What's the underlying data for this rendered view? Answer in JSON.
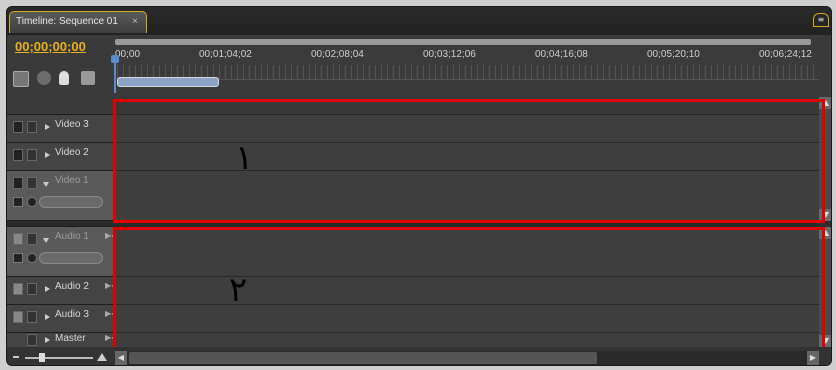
{
  "panel": {
    "tab_title": "Timeline: Sequence 01",
    "tab_close": "×",
    "menu_glyph": "≡"
  },
  "header": {
    "timecode": "00;00;00;00",
    "ruler_ticks": [
      "00;00",
      "00;01;04;02",
      "00;02;08;04",
      "00;03;12;06",
      "00;04;16;08",
      "00;05;20;10",
      "00;06;24;12"
    ]
  },
  "video_tracks": [
    {
      "name": "Video 3",
      "expanded": false
    },
    {
      "name": "Video 2",
      "expanded": false
    },
    {
      "name": "Video 1",
      "expanded": true
    }
  ],
  "audio_tracks": [
    {
      "name": "Audio 1",
      "expanded": true
    },
    {
      "name": "Audio 2",
      "expanded": false
    },
    {
      "name": "Audio 3",
      "expanded": false
    },
    {
      "name": "Master",
      "expanded": false
    }
  ],
  "annotations": {
    "video_label": "١",
    "audio_label": "٢"
  },
  "colors": {
    "highlight": "#e00000",
    "timecode": "#e8b020",
    "tab_border": "#d9a820"
  }
}
